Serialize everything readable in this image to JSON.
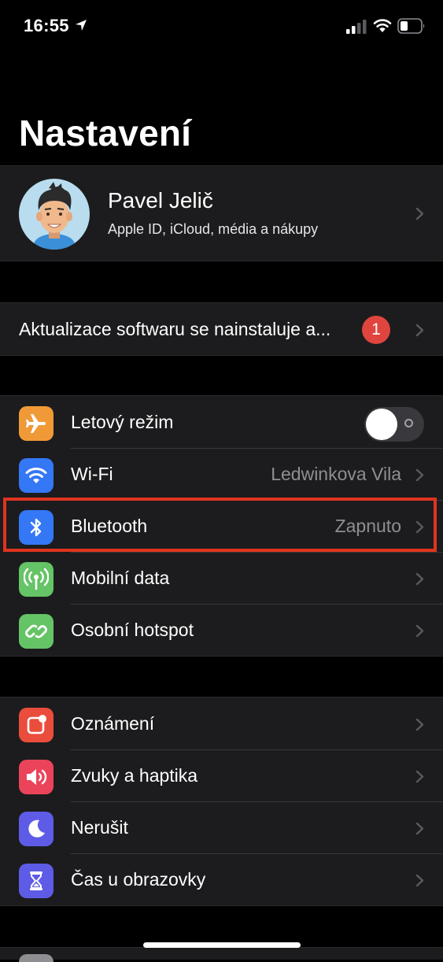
{
  "status_bar": {
    "time": "16:55",
    "icons": [
      "location-arrow-icon",
      "cellular-signal-icon",
      "wifi-icon",
      "battery-icon"
    ]
  },
  "page": {
    "title": "Nastavení"
  },
  "profile": {
    "name": "Pavel Jelič",
    "subtitle": "Apple ID, iCloud, média a nákupy"
  },
  "update": {
    "label": "Aktualizace softwaru se nainstaluje a...",
    "badge": "1"
  },
  "connectivity": [
    {
      "label": "Letový režim",
      "icon": "airplane-icon",
      "color": "#f09a37",
      "toggle": false
    },
    {
      "label": "Wi-Fi",
      "value": "Ledwinkova Vila",
      "icon": "wifi-icon",
      "color": "#3478f6"
    },
    {
      "label": "Bluetooth",
      "value": "Zapnuto",
      "icon": "bluetooth-icon",
      "color": "#3478f6",
      "highlighted": true
    },
    {
      "label": "Mobilní data",
      "icon": "antenna-icon",
      "color": "#65c466"
    },
    {
      "label": "Osobní hotspot",
      "icon": "hotspot-icon",
      "color": "#65c466"
    }
  ],
  "notifications_group": [
    {
      "label": "Oznámení",
      "icon": "notifications-icon",
      "color": "#eb4d3d"
    },
    {
      "label": "Zvuky a haptika",
      "icon": "speaker-icon",
      "color": "#eb445a"
    },
    {
      "label": "Nerušit",
      "icon": "moon-icon",
      "color": "#5e5ce6"
    },
    {
      "label": "Čas u obrazovky",
      "icon": "hourglass-icon",
      "color": "#5e5ce6"
    }
  ],
  "colors": {
    "background": "#000000",
    "cell": "#1c1c1e",
    "highlight_border": "#e0341f",
    "badge": "#e0443e"
  }
}
